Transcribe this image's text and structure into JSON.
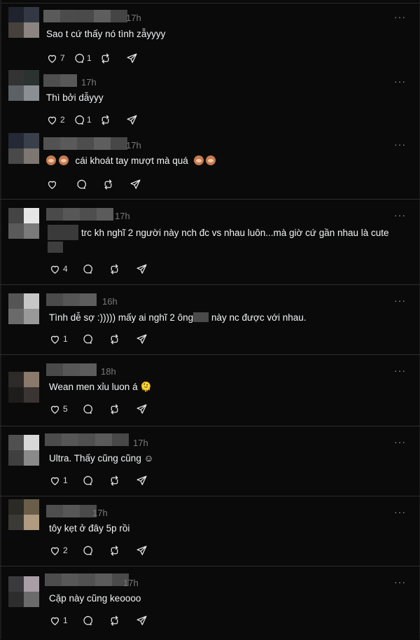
{
  "comments": [
    {
      "time": "17h",
      "text": "Sao t cứ thấy nó tình zẫyyyy",
      "likes": "7",
      "replies": "1"
    },
    {
      "time": "17h",
      "text": "Thì bởi dẫyyy",
      "likes": "2",
      "replies": "1"
    },
    {
      "time": "17h",
      "text": "cái khoát tay mượt mà quá",
      "likes": "",
      "replies": ""
    },
    {
      "time": "17h",
      "text_a": "trc kh nghĩ 2 người này nch đc vs nhau luôn...mà giờ cứ gần nhau là cute",
      "likes": "4",
      "replies": ""
    },
    {
      "time": "16h",
      "text_a": "Tình dễ sợ :))))) mấy ai nghĩ 2 ông",
      "text_b": "này nc được với nhau.",
      "likes": "1",
      "replies": ""
    },
    {
      "time": "18h",
      "text": "Wean men xỉu luon á 🫠",
      "likes": "5",
      "replies": ""
    },
    {
      "time": "17h",
      "text": "Ultra. Thấy cũng cũng ☺",
      "likes": "1",
      "replies": ""
    },
    {
      "time": "17h",
      "text": "tôy kẹt ở đây 5p rồi",
      "likes": "2",
      "replies": ""
    },
    {
      "time": "17h",
      "text": "Cặp này cũng keoooo",
      "likes": "1",
      "replies": ""
    }
  ],
  "more_label": "···",
  "colors": {
    "background": "#0a0a0a",
    "text": "#f3f5f7",
    "muted": "#7a7a7a",
    "divider": "#2d2d2d"
  },
  "icons": [
    "heart-icon",
    "comment-icon",
    "repost-icon",
    "share-icon",
    "more-icon"
  ]
}
